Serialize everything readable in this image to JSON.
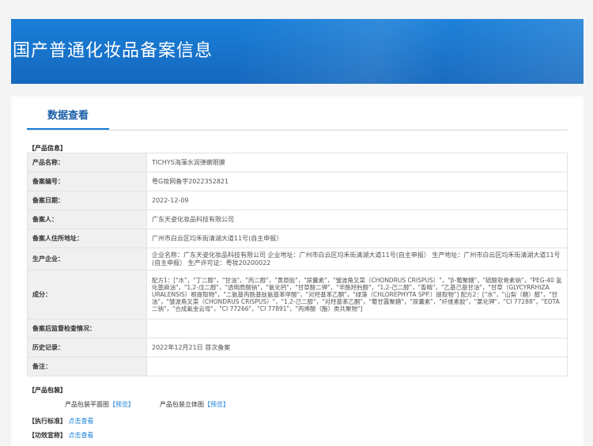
{
  "header": {
    "title": "国产普通化妆品备案信息"
  },
  "tabs": [
    {
      "label": "数据查看"
    }
  ],
  "product_info": {
    "section_label": "【产品信息】",
    "rows": [
      {
        "label": "产品名称：",
        "value": "TICHYS海藻水润弹嫩眼膜"
      },
      {
        "label": "备案编号：",
        "value": "粤G妆网备字2022352821"
      },
      {
        "label": "备案日期：",
        "value": "2022-12-09"
      },
      {
        "label": "备案人：",
        "value": "广东天姿化妆品科技有限公司"
      },
      {
        "label": "备案人住所地址：",
        "value": "广州市白云区均禾街清湖大道11号(自主申报）"
      },
      {
        "label": "生产企业：",
        "value": "企业名称：广东天姿化妆品科技有限公司 企业地址：广州市白云区均禾街清湖大道11号(自主申报） 生产地址：广州市白云区均禾街清湖大道11号(自主申报） 生产许可证：粤妆20200022"
      },
      {
        "label": "成分：",
        "value": "配方1：[\"水\"，\"丁二醇\"，\"甘油\"，\"丙二醇\"，\"黄原胶\"，\"尿囊素\"，\"皱波角叉菜（CHONDRUS CRISPUS）\"，\"β-葡聚糖\"，\"硫酸软骨素钠\"，\"PEG-40 氢化蓖麻油\"，\"1,2-戊二醇\"，\"透明质酸钠\"，\"氨化钙\"，\"甘草酸二钾\"，\"辛酰羟肟酸\"，\"1,2-己二醇\"，\"香精\"，\"乙基己基甘油\"，\"甘草（GLYCYRRHIZA URALENSIS）根提取物\"，\"二氨基丙酰基肽氨基苯甲酸\"，\"对羟基苯乙酮\"，\"绿藻（CHLOREPHYTA SPP.）提取物\"] 配方2：[\"水\"，\"山梨（糖）醇\"，\"甘油\"，\"皱波角叉菜（CHONDRUS CRISPUS）\"，\"1,2-己二醇\"，\"对羟基苯乙酮\"，\"葡甘露聚糖\"，\"尿囊素\"，\"纤维素胶\"，\"氯化钾\"，\"CI 77288\"，\"EDTA 二钠\"，\"合成氟金云母\"，\"CI 77266\"，\"CI 77891\"，\"丙烯酸（酯）类共聚物\"]"
      },
      {
        "label": "备案后监督检查情况：",
        "value": ""
      },
      {
        "label": "历史记录：",
        "value": "2022年12月21日 首次备案"
      },
      {
        "label": "备注：",
        "value": ""
      }
    ]
  },
  "packaging": {
    "section_label": "【产品包装】",
    "flat_label": "产品包装平面图",
    "flat_link": "【预览】",
    "stereo_label": "产品包装立体图",
    "stereo_link": "【预览】"
  },
  "standard": {
    "label": "【执行标准】",
    "link": "点击查看"
  },
  "efficacy": {
    "label": "【功效宣称】",
    "link": "点击查看"
  },
  "colors": {
    "accent": "#1a7fd8",
    "link": "#1a7fd8"
  }
}
